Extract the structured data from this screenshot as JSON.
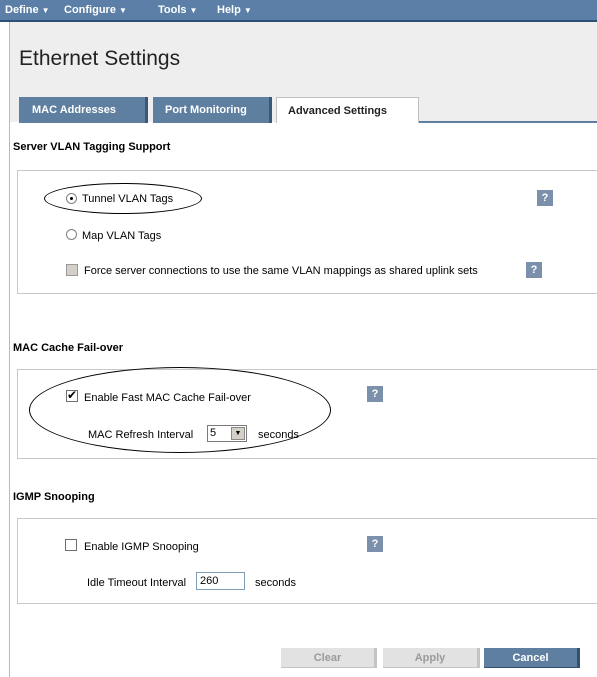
{
  "menu": {
    "items": [
      {
        "label": "Define"
      },
      {
        "label": "Configure"
      },
      {
        "label": "Tools"
      },
      {
        "label": "Help"
      }
    ]
  },
  "page": {
    "title": "Ethernet Settings"
  },
  "tabs": [
    {
      "label": "MAC Addresses",
      "active": false
    },
    {
      "label": "Port Monitoring",
      "active": false
    },
    {
      "label": "Advanced Settings",
      "active": true
    }
  ],
  "vlan": {
    "title": "Server VLAN Tagging Support",
    "tunnel_label": "Tunnel VLAN Tags",
    "tunnel_selected": true,
    "map_label": "Map VLAN Tags",
    "map_selected": false,
    "force_label": "Force server connections to use the same VLAN mappings as shared uplink sets",
    "force_checked": false,
    "force_disabled": true
  },
  "mac_cache": {
    "title": "MAC Cache Fail-over",
    "enable_label": "Enable Fast MAC Cache Fail-over",
    "enable_checked": true,
    "refresh_label": "MAC Refresh Interval",
    "refresh_value": "5",
    "refresh_unit": "seconds"
  },
  "igmp": {
    "title": "IGMP Snooping",
    "enable_label": "Enable IGMP Snooping",
    "enable_checked": false,
    "timeout_label": "Idle Timeout Interval",
    "timeout_value": "260",
    "timeout_unit": "seconds"
  },
  "help_glyph": "?",
  "buttons": {
    "clear": "Clear",
    "apply": "Apply",
    "cancel": "Cancel"
  },
  "colors": {
    "menubar": "#5b7fa7",
    "tab_inactive": "#5f7fa1",
    "help_icon": "#7b91ab"
  }
}
